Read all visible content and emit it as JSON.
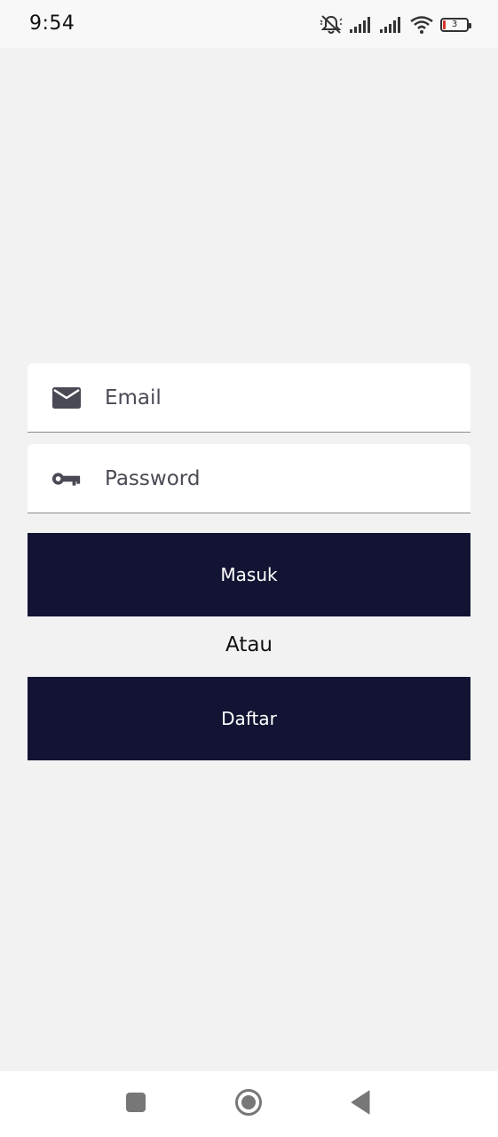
{
  "status_bar": {
    "time": "9:54",
    "battery_level": "3",
    "icons": [
      "mute-icon",
      "signal-icon",
      "signal-icon",
      "wifi-icon",
      "battery-icon"
    ]
  },
  "login_form": {
    "email": {
      "icon": "mail-icon",
      "placeholder": "Email",
      "value": ""
    },
    "password": {
      "icon": "key-icon",
      "placeholder": "Password",
      "value": ""
    },
    "login_label": "Masuk",
    "or_label": "Atau",
    "register_label": "Daftar"
  },
  "nav_bar": {
    "icons": [
      "recent-apps-icon",
      "home-icon",
      "back-icon"
    ]
  },
  "colors": {
    "background": "#f2f2f3",
    "button": "#131433",
    "button_text": "#ffffff",
    "field_background": "#ffffff",
    "battery_low": "#d9342b"
  }
}
